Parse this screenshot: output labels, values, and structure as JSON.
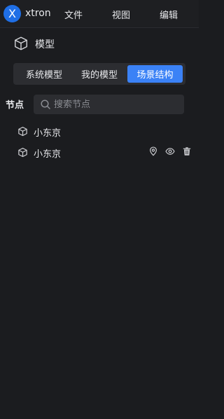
{
  "app": {
    "logo_letter": "X",
    "name": "xtron"
  },
  "menu": {
    "file": "文件",
    "view": "视图",
    "edit": "编辑"
  },
  "section": {
    "title": "模型",
    "icon": "cube-icon"
  },
  "tabs": [
    {
      "label": "系统模型",
      "active": false
    },
    {
      "label": "我的模型",
      "active": false
    },
    {
      "label": "场景结构",
      "active": true
    }
  ],
  "search": {
    "label": "节点",
    "placeholder": "搜索节点",
    "value": ""
  },
  "tree": {
    "items": [
      {
        "label": "小东京",
        "icon": "cube-icon",
        "actions": []
      },
      {
        "label": "小东京",
        "icon": "cube-icon",
        "actions": [
          "location-pin-icon",
          "eye-icon",
          "trash-icon"
        ]
      }
    ]
  },
  "colors": {
    "accent": "#3b82f6",
    "background": "#1b1c1f",
    "panel": "#2c2d31",
    "logo": "#1f6fe6"
  }
}
